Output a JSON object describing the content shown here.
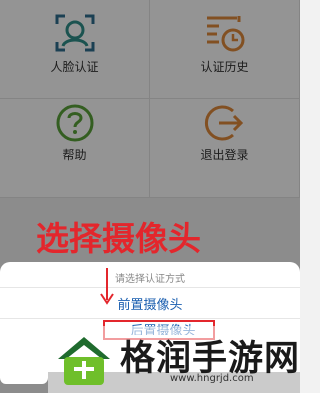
{
  "menu": {
    "items": [
      {
        "label": "人脸认证",
        "icon": "face-scan-icon"
      },
      {
        "label": "认证历史",
        "icon": "history-clock-icon"
      },
      {
        "label": "帮助",
        "icon": "help-question-icon"
      },
      {
        "label": "退出登录",
        "icon": "logout-icon"
      }
    ]
  },
  "annotation": {
    "title": "选择摄像头"
  },
  "sheet": {
    "title": "请选择认证方式",
    "option_front": "前置摄像头",
    "option_back": "后置摄像头"
  },
  "watermark": {
    "text": "格润手游网",
    "url": "www.hngrjd.com"
  },
  "colors": {
    "accent_red": "#e3262c",
    "option_blue": "#1b5fb0",
    "icon_teal": "#2f6f8f",
    "icon_green": "#5aa33a",
    "icon_orange": "#e08a3c"
  }
}
